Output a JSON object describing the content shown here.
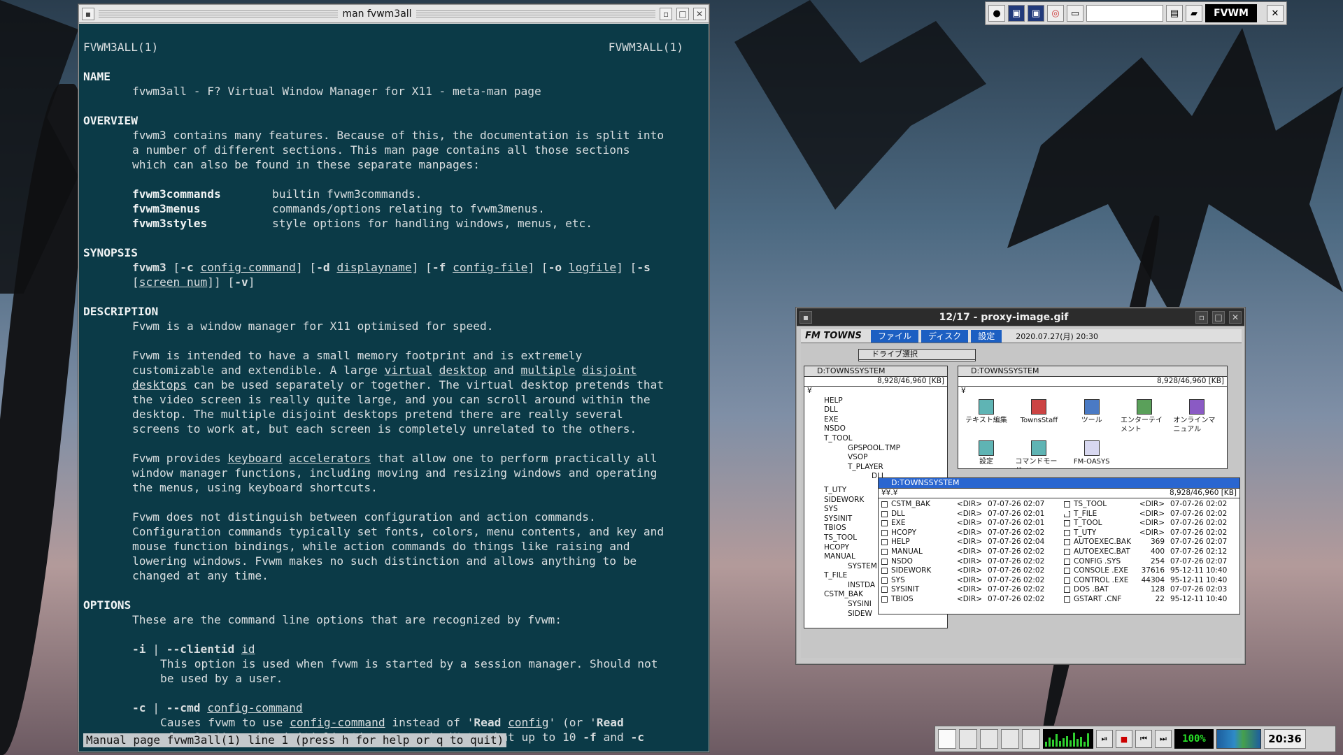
{
  "terminal": {
    "title": "man fvwm3all",
    "header_left": "FVWM3ALL(1)",
    "header_right": "FVWM3ALL(1)",
    "name_heading": "NAME",
    "name_line": "fvwm3all - F? Virtual Window Manager for X11 - meta-man page",
    "overview_heading": "OVERVIEW",
    "overview_lines": [
      "fvwm3 contains many features. Because of this, the documentation is split into",
      "a number of different sections. This man page contains all those sections",
      "which can also be found in these separate manpages:"
    ],
    "manpages": [
      {
        "cmd": "fvwm3commands",
        "desc": "builtin fvwm3commands."
      },
      {
        "cmd": "fvwm3menus",
        "desc": "commands/options relating to fvwm3menus."
      },
      {
        "cmd": "fvwm3styles",
        "desc": "style options for handling windows, menus, etc."
      }
    ],
    "synopsis_heading": "SYNOPSIS",
    "description_heading": "DESCRIPTION",
    "desc_p1": "Fvwm is a window manager for X11 optimised for speed.",
    "desc_p2_l1": "Fvwm is intended to have a small memory footprint and is extremely",
    "desc_p2_l2a": "customizable and extendible. A large ",
    "desc_p2_l3b": " can be used separately or together. The virtual desktop pretends that",
    "desc_p2_rest": [
      "the video screen is really quite large, and you can scroll around within the",
      "desktop. The multiple disjoint desktops pretend there are really several",
      "screens to work at, but each screen is completely unrelated to the others."
    ],
    "desc_p3_rest": [
      "window manager functions, including moving and resizing windows and operating",
      "the menus, using keyboard shortcuts."
    ],
    "desc_p4": [
      "Fvwm does not distinguish between configuration and action commands.",
      "Configuration commands typically set fonts, colors, menu contents, and key and",
      "mouse function bindings, while action commands do things like raising and",
      "lowering windows. Fvwm makes no such distinction and allows anything to be",
      "changed at any time."
    ],
    "options_heading": "OPTIONS",
    "options_intro": "These are the command line options that are recognized by fvwm:",
    "opt_i_desc": [
      "This option is used when fvwm is started by a session manager. Should not",
      "be used by a user."
    ],
    "status": "Manual page fvwm3all(1) line 1 (press h for help or q to quit)"
  },
  "top_panel": {
    "field_text": "",
    "logo": "FVWM"
  },
  "viewer": {
    "title": "12/17 - proxy-image.gif",
    "menu_logo": "FM TOWNS",
    "menu": [
      "ファイル",
      "ディスク",
      "設定"
    ],
    "clock": "2020.07.27(月) 20:30",
    "drive_select": "ドライブ選択",
    "tree_title": "D:TOWNSSYSTEM",
    "tree_info": "8,928/46,960 [KB]",
    "tree_items": [
      "¥",
      "HELP",
      "DLL",
      "EXE",
      "NSDO",
      "T_TOOL",
      "GPSPOOL.TMP",
      "VSOP",
      "T_PLAYER",
      "DLL",
      "T_UTY",
      "SIDEWORK",
      "SYS",
      "SYSINIT",
      "TBIOS",
      "TS_TOOL",
      "HCOPY",
      "MANUAL",
      "SYSTEM",
      "T_FILE",
      "INSTDA",
      "CSTM_BAK",
      "SYSINI",
      "SIDEW"
    ],
    "icon_title": "D:TOWNSSYSTEM",
    "icon_info": "8,928/46,960 [KB]",
    "icon_path": "¥",
    "icons": [
      "テキスト編集",
      "TownsStaff",
      "ツール",
      "エンターテイメント",
      "オンラインマニュアル",
      "設定",
      "コマンドモード",
      "FM-OASYS"
    ],
    "list_title": "D:TOWNSSYSTEM",
    "list_info": "8,928/46,960 [KB]",
    "list_path": "¥¥.¥",
    "files_left": [
      [
        "CSTM_BAK",
        "<DIR>",
        "07-07-26 02:07"
      ],
      [
        "DLL",
        "<DIR>",
        "07-07-26 02:01"
      ],
      [
        "EXE",
        "<DIR>",
        "07-07-26 02:01"
      ],
      [
        "HCOPY",
        "<DIR>",
        "07-07-26 02:02"
      ],
      [
        "HELP",
        "<DIR>",
        "07-07-26 02:04"
      ],
      [
        "MANUAL",
        "<DIR>",
        "07-07-26 02:02"
      ],
      [
        "NSDO",
        "<DIR>",
        "07-07-26 02:02"
      ],
      [
        "SIDEWORK",
        "<DIR>",
        "07-07-26 02:02"
      ],
      [
        "SYS",
        "<DIR>",
        "07-07-26 02:02"
      ],
      [
        "SYSINIT",
        "<DIR>",
        "07-07-26 02:02"
      ],
      [
        "TBIOS",
        "<DIR>",
        "07-07-26 02:02"
      ]
    ],
    "files_right": [
      [
        "TS_TOOL",
        "<DIR>",
        "07-07-26 02:02"
      ],
      [
        "T_FILE",
        "<DIR>",
        "07-07-26 02:02"
      ],
      [
        "T_TOOL",
        "<DIR>",
        "07-07-26 02:02"
      ],
      [
        "T_UTY",
        "<DIR>",
        "07-07-26 02:02"
      ],
      [
        "AUTOEXEC.BAK",
        "369",
        "07-07-26 02:07"
      ],
      [
        "AUTOEXEC.BAT",
        "400",
        "07-07-26 02:12"
      ],
      [
        "CONFIG .SYS",
        "254",
        "07-07-26 02:07"
      ],
      [
        "CONSOLE .EXE",
        "37616",
        "95-12-11 10:40"
      ],
      [
        "CONTROL .EXE",
        "44304",
        "95-12-11 10:40"
      ],
      [
        "DOS .BAT",
        "128",
        "07-07-26 02:03"
      ],
      [
        "GSTART .CNF",
        "22",
        "95-12-11 10:40"
      ]
    ]
  },
  "bottom_panel": {
    "volume": "100%",
    "time": "20:36"
  }
}
